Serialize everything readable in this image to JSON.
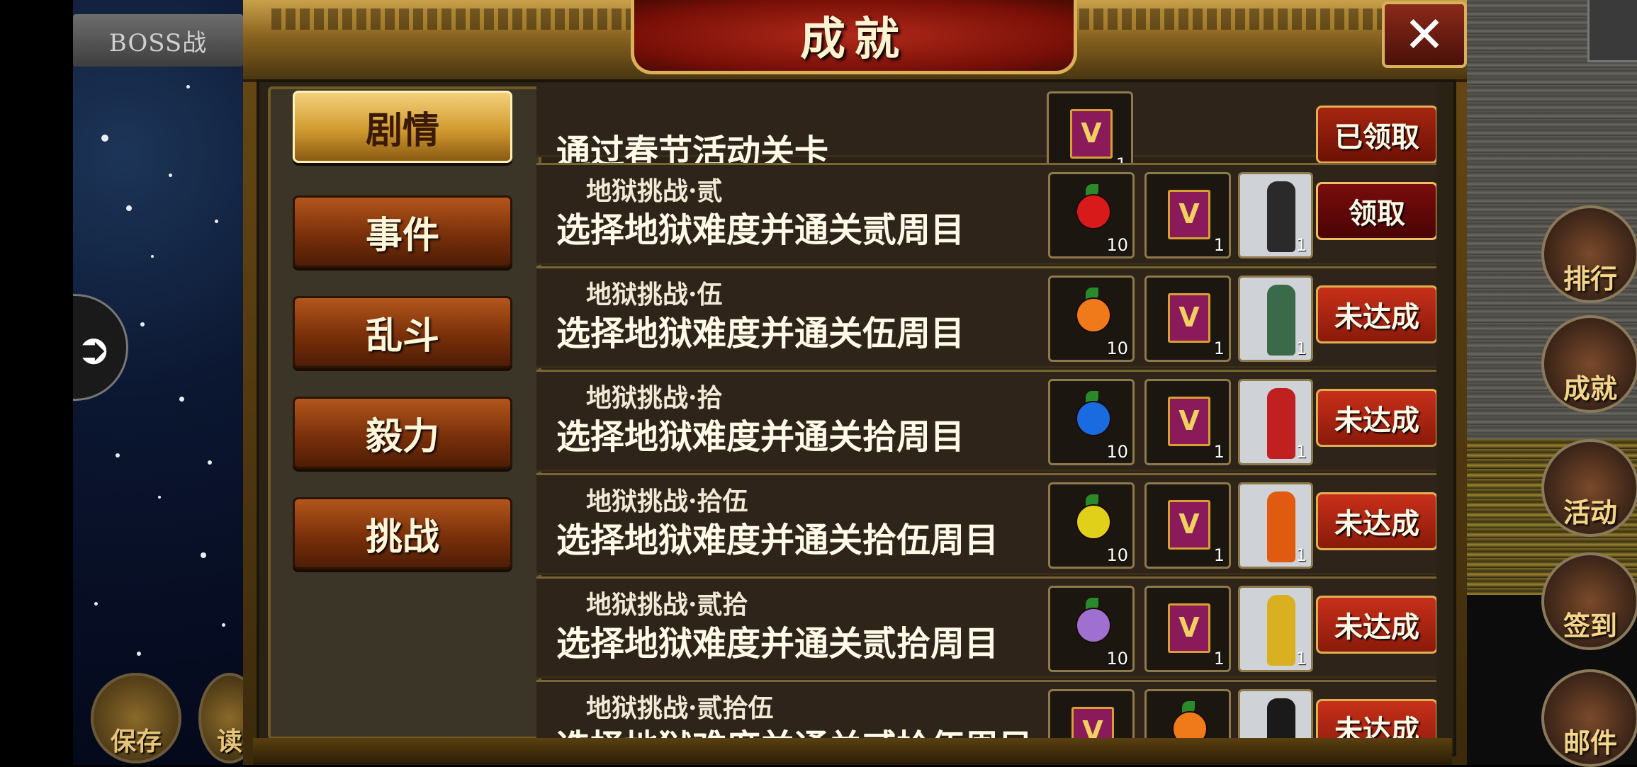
{
  "left_panel": {
    "boss_tab_label": "BOSS战",
    "bottom_buttons": [
      {
        "label": "保存"
      },
      {
        "label": "读"
      }
    ]
  },
  "dialog": {
    "title": "成就",
    "close_label": "✕",
    "tabs": [
      {
        "label": "剧情",
        "active": true
      },
      {
        "label": "事件",
        "active": false
      },
      {
        "label": "乱斗",
        "active": false
      },
      {
        "label": "毅力",
        "active": false
      },
      {
        "label": "挑战",
        "active": false
      }
    ],
    "achievements": [
      {
        "title": "",
        "description": "通过春节活动关卡",
        "rewards": [
          {
            "type": "book",
            "icon": "v-book-icon",
            "count": "1"
          }
        ],
        "status": "已领取"
      },
      {
        "title": "地狱挑战·贰",
        "description": "选择地狱难度并通关贰周目",
        "rewards": [
          {
            "type": "fruit",
            "icon": "red-fruit-icon",
            "color": "#d81a1a",
            "count": "10"
          },
          {
            "type": "book",
            "icon": "v-book-icon",
            "count": "1"
          },
          {
            "type": "portrait",
            "icon": "dark-winged-hero-portrait",
            "color": "#2a2a2a",
            "count": "1"
          }
        ],
        "status": "领取"
      },
      {
        "title": "地狱挑战·伍",
        "description": "选择地狱难度并通关伍周目",
        "rewards": [
          {
            "type": "fruit",
            "icon": "orange-fruit-icon",
            "color": "#f07a1a",
            "count": "10"
          },
          {
            "type": "book",
            "icon": "v-book-icon",
            "count": "1"
          },
          {
            "type": "portrait",
            "icon": "green-swordsman-portrait",
            "color": "#3a6a4a",
            "count": "1"
          }
        ],
        "status": "未达成"
      },
      {
        "title": "地狱挑战·拾",
        "description": "选择地狱难度并通关拾周目",
        "rewards": [
          {
            "type": "fruit",
            "icon": "blue-fruit-icon",
            "color": "#1a6ae0",
            "count": "10"
          },
          {
            "type": "book",
            "icon": "v-book-icon",
            "count": "1"
          },
          {
            "type": "portrait",
            "icon": "red-hair-fighter-portrait",
            "color": "#c02020",
            "count": "1"
          }
        ],
        "status": "未达成"
      },
      {
        "title": "地狱挑战·拾伍",
        "description": "选择地狱难度并通关拾伍周目",
        "rewards": [
          {
            "type": "fruit",
            "icon": "yellow-fruit-icon",
            "color": "#e0d01a",
            "count": "10"
          },
          {
            "type": "book",
            "icon": "v-book-icon",
            "count": "1"
          },
          {
            "type": "portrait",
            "icon": "flame-warrior-portrait",
            "color": "#e05a10",
            "count": "1"
          }
        ],
        "status": "未达成"
      },
      {
        "title": "地狱挑战·贰拾",
        "description": "选择地狱难度并通关贰拾周目",
        "rewards": [
          {
            "type": "fruit",
            "icon": "purple-fruit-icon",
            "color": "#a070d0",
            "count": "10"
          },
          {
            "type": "book",
            "icon": "v-book-icon",
            "count": "1"
          },
          {
            "type": "portrait",
            "icon": "gold-armor-knight-portrait",
            "color": "#d8b020",
            "count": "1"
          }
        ],
        "status": "未达成"
      },
      {
        "title": "地狱挑战·贰拾伍",
        "description": "选择地狱难度并通关贰拾伍周目",
        "rewards": [
          {
            "type": "book",
            "icon": "v-book-icon",
            "count": ""
          },
          {
            "type": "fruit",
            "icon": "orange-fruit-icon",
            "color": "#f07a1a",
            "count": ""
          },
          {
            "type": "portrait",
            "icon": "black-hair-fighter-portrait",
            "color": "#1a1a1a",
            "count": ""
          }
        ],
        "status": "未达成"
      }
    ]
  },
  "right_panel": {
    "menu": [
      {
        "label": "排行",
        "icon": "ranking-icon"
      },
      {
        "label": "成就",
        "icon": "achievement-icon"
      },
      {
        "label": "活动",
        "icon": "event-icon"
      },
      {
        "label": "签到",
        "icon": "checkin-icon"
      },
      {
        "label": "邮件",
        "icon": "mail-icon"
      }
    ]
  }
}
